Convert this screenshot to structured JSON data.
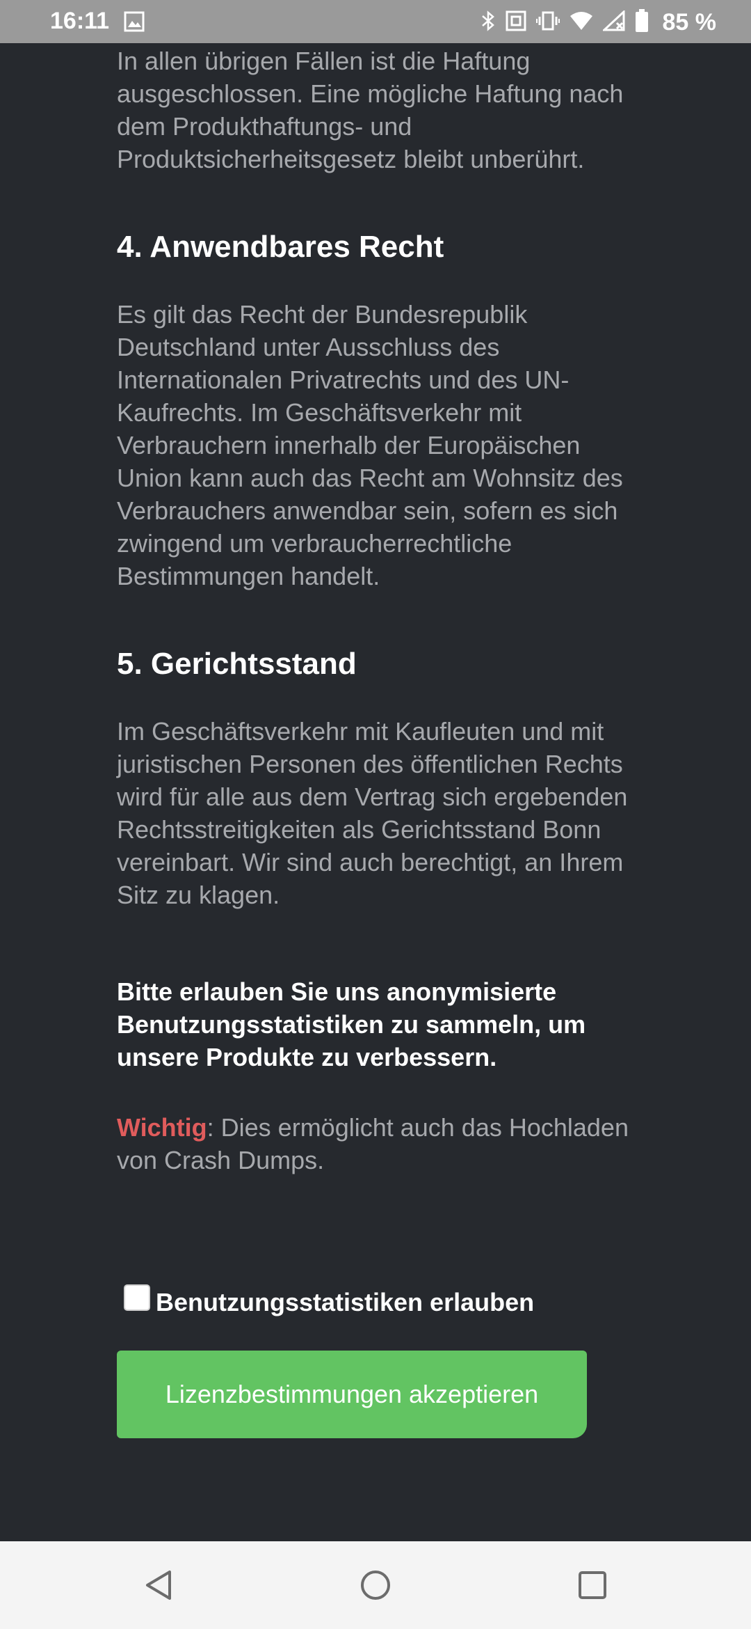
{
  "status_bar": {
    "time": "16:11",
    "battery": "85 %",
    "icons": [
      "gallery-icon",
      "bluetooth-icon",
      "nfc-icon",
      "vibrate-icon",
      "wifi-icon",
      "signal-icon",
      "battery-icon"
    ]
  },
  "sections": {
    "liability_end": "In allen übrigen Fällen ist die Haftung ausgeschlossen. Eine mögliche Haftung nach dem Produkthaftungs- und Produktsicherheitsgesetz bleibt unberührt.",
    "law_heading": "4. Anwendbares Recht",
    "law_body": "Es gilt das Recht der Bundesrepublik Deutschland unter Ausschluss des Internationalen Privatrechts und des UN-Kaufrechts. Im Geschäftsverkehr mit Verbrauchern innerhalb der Europäischen Union kann auch das Recht am Wohnsitz des Verbrauchers anwendbar sein, sofern es sich zwingend um verbraucherrechtliche Bestimmungen handelt.",
    "court_heading": "5. Gerichtsstand",
    "court_body": "Im Geschäftsverkehr mit Kaufleuten und mit juristischen Personen des öffentlichen Rechts wird für alle aus dem Vertrag sich ergebenden Rechtsstreitigkeiten als Gerichtsstand Bonn vereinbart. Wir sind auch berechtigt, an Ihrem Sitz zu klagen."
  },
  "statistics": {
    "request": "Bitte erlauben Sie uns anonymisierte Benutzungsstatistiken zu sammeln, um unsere Produkte zu verbessern.",
    "important_label": "Wichtig",
    "important_text": ": Dies ermöglicht auch das Hochladen von Crash Dumps.",
    "checkbox_label": "Benutzungsstatistiken erlauben",
    "checkbox_checked": false
  },
  "accept_button": "Lizenzbestimmungen akzeptieren",
  "colors": {
    "background": "#26292e",
    "button": "#62c462",
    "important": "#e05c5c"
  }
}
